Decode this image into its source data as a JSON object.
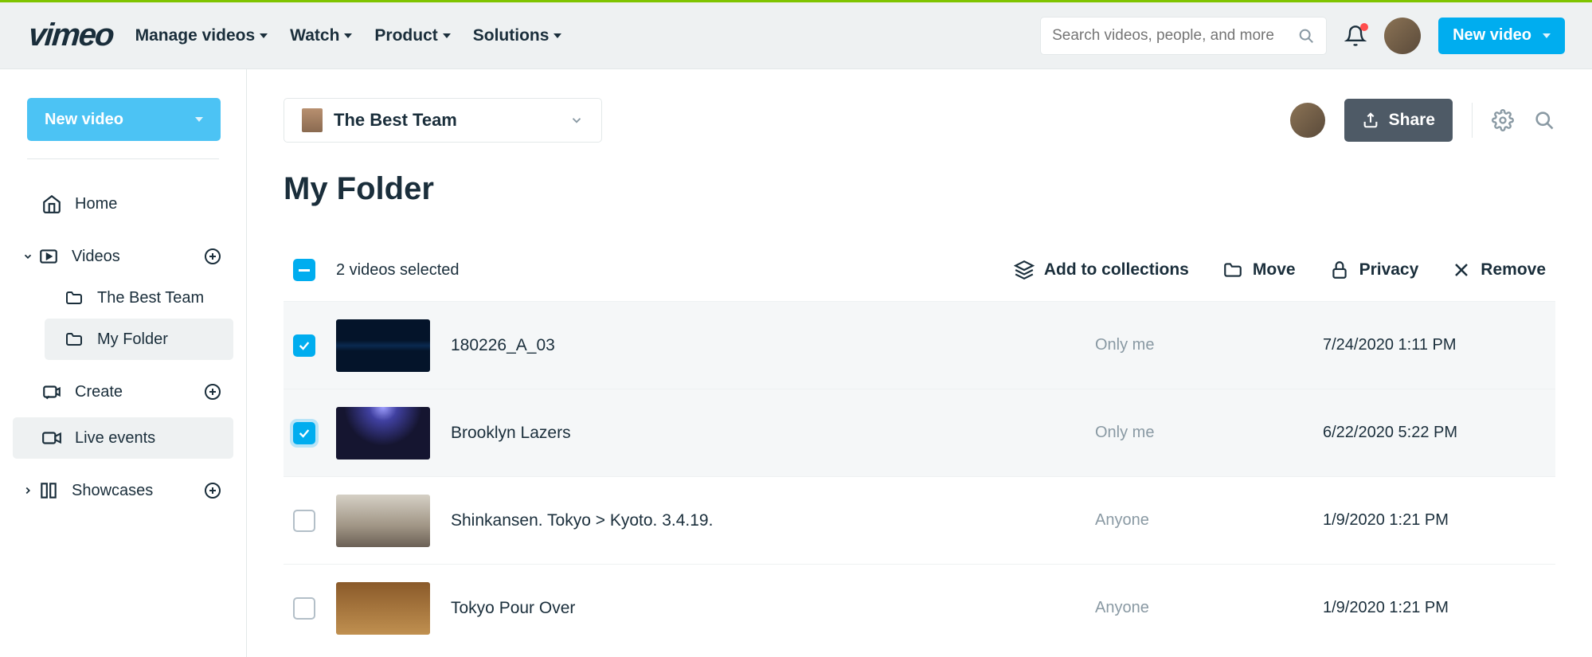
{
  "header": {
    "logo": "vimeo",
    "nav": [
      "Manage videos",
      "Watch",
      "Product",
      "Solutions"
    ],
    "search_placeholder": "Search videos, people, and more",
    "new_video": "New video"
  },
  "sidebar": {
    "new_video": "New video",
    "items": [
      {
        "key": "home",
        "label": "Home"
      },
      {
        "key": "videos",
        "label": "Videos",
        "expandable": true,
        "expanded": true,
        "add": true
      },
      {
        "key": "create",
        "label": "Create",
        "add": true
      },
      {
        "key": "live",
        "label": "Live events"
      },
      {
        "key": "showcases",
        "label": "Showcases",
        "expandable": true,
        "expanded": false,
        "add": true
      }
    ],
    "video_children": [
      {
        "key": "best-team",
        "label": "The Best Team"
      },
      {
        "key": "my-folder",
        "label": "My Folder",
        "active": true
      }
    ]
  },
  "main": {
    "team": "The Best Team",
    "share": "Share",
    "title": "My Folder",
    "selection": {
      "count_text": "2 videos selected",
      "actions": [
        "Add to collections",
        "Move",
        "Privacy",
        "Remove"
      ]
    },
    "rows": [
      {
        "selected": true,
        "title": "180226_A_03",
        "privacy": "Only me",
        "date": "7/24/2020 1:11 PM",
        "thumb": "wave"
      },
      {
        "selected": true,
        "focused": true,
        "title": "Brooklyn Lazers",
        "privacy": "Only me",
        "date": "6/22/2020 5:22 PM",
        "thumb": "lazers"
      },
      {
        "selected": false,
        "title": "Shinkansen. Tokyo > Kyoto. 3.4.19.",
        "privacy": "Anyone",
        "date": "1/9/2020 1:21 PM",
        "thumb": "tokyo"
      },
      {
        "selected": false,
        "title": "Tokyo Pour Over",
        "privacy": "Anyone",
        "date": "1/9/2020 1:21 PM",
        "thumb": "pour"
      }
    ]
  }
}
